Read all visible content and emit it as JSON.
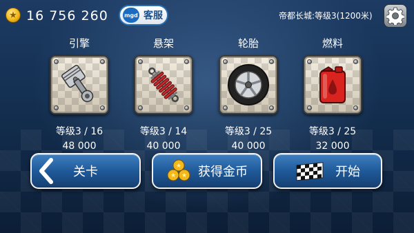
{
  "topbar": {
    "coins": "16 756 260",
    "service_badge": "mgd",
    "service_label": "客服",
    "level_info": "帝都长城:等级3(1200米)"
  },
  "parts": [
    {
      "name": "引擎",
      "icon": "engine-piston-icon",
      "level": "等级3 / 16",
      "price": "48 000"
    },
    {
      "name": "悬架",
      "icon": "suspension-spring-icon",
      "level": "等级3 / 14",
      "price": "40 000"
    },
    {
      "name": "轮胎",
      "icon": "tire-wheel-icon",
      "level": "等级3 / 25",
      "price": "40 000"
    },
    {
      "name": "燃料",
      "icon": "fuel-can-icon",
      "level": "等级3 / 25",
      "price": "32 000"
    }
  ],
  "buttons": {
    "back_label": "关卡",
    "coins_label": "获得金币",
    "start_label": "开始"
  },
  "colors": {
    "accent_blue": "#1f5a9a",
    "coin_gold": "#f2b81c",
    "fuel_red": "#d8231e",
    "suspension_red": "#c0282a"
  }
}
